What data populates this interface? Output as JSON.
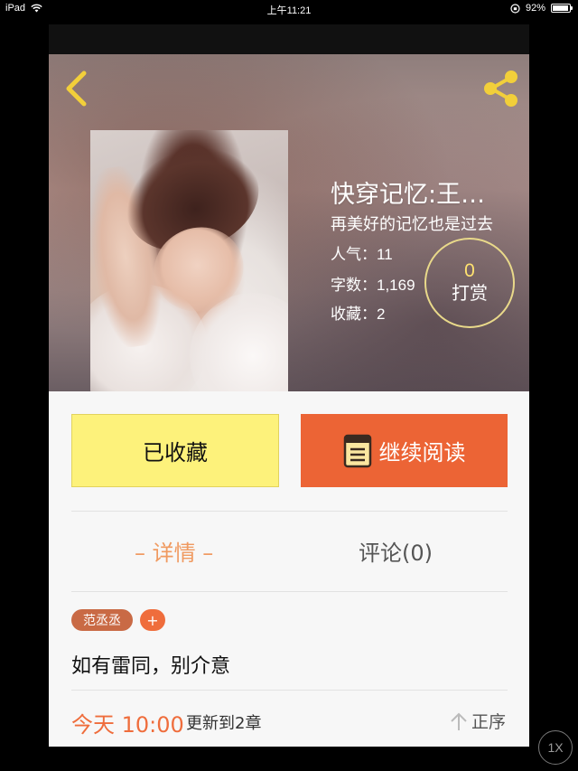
{
  "status_bar": {
    "device": "iPad",
    "time": "上午11:21",
    "battery": "92%",
    "battery_level": 0.92
  },
  "header": {
    "back_icon": "chevron-left-icon",
    "share_icon": "share-icon"
  },
  "book": {
    "title": "快穿记忆:王…",
    "subtitle": "再美好的记忆也是过去",
    "popularity_label": "人气：",
    "popularity_value": "11",
    "words_label": "字数：",
    "words_value": "1,169",
    "favorites_label": "收藏：",
    "favorites_value": "2",
    "reward_count": "0",
    "reward_label": "打赏"
  },
  "actions": {
    "favorited_label": "已收藏",
    "continue_label": "继续阅读",
    "continue_icon": "book-icon"
  },
  "tabs": {
    "detail": "– 详情 –",
    "comments": "评论(0)"
  },
  "tags": {
    "author": "范丞丞",
    "add": "+"
  },
  "description": "如有雷同，别介意",
  "update": {
    "time": "今天 10:00",
    "text": "更新到2章",
    "order": "正序",
    "order_icon": "arrow-up-icon"
  },
  "overlay": {
    "speed": "1X"
  },
  "colors": {
    "accent": "#ec6435",
    "favorite_bg": "#fdf27b",
    "tab_active": "#f09a60",
    "reward_count": "#ffe270"
  }
}
